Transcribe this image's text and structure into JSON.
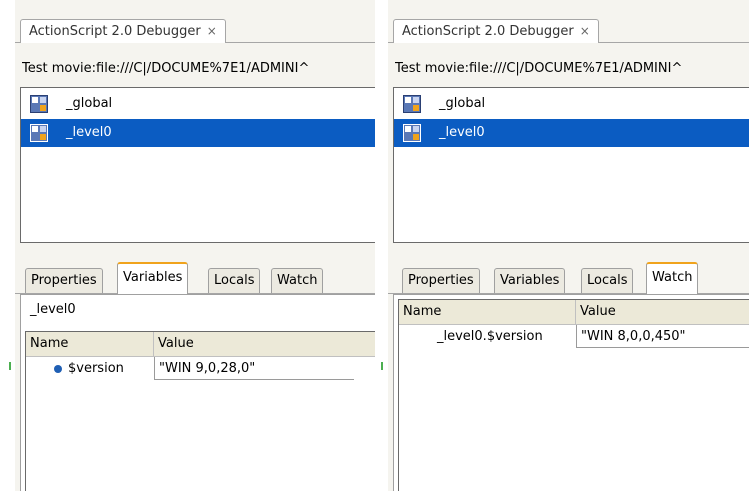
{
  "left": {
    "tab_title": "ActionScript 2.0 Debugger",
    "close_glyph": "×",
    "movie_path": "Test movie:file:///C|/DOCUME%7E1/ADMINI^",
    "tree": [
      {
        "label": "_global",
        "icon": "movieclip-icon",
        "selected": false
      },
      {
        "label": "_level0",
        "icon": "movieclip-icon",
        "selected": true
      }
    ],
    "tabs": [
      "Properties",
      "Variables",
      "Locals",
      "Watch"
    ],
    "active_tab": "Variables",
    "level_label": "_level0",
    "grid": {
      "headers": [
        "Name",
        "Value"
      ],
      "rows": [
        {
          "name": "$version",
          "value": "\"WIN 9,0,28,0\"",
          "bullet": "dot-icon"
        }
      ]
    }
  },
  "right": {
    "tab_title": "ActionScript 2.0 Debugger",
    "close_glyph": "×",
    "movie_path": "Test movie:file:///C|/DOCUME%7E1/ADMINI^",
    "tree": [
      {
        "label": "_global",
        "icon": "movieclip-icon",
        "selected": false
      },
      {
        "label": "_level0",
        "icon": "movieclip-icon",
        "selected": true
      }
    ],
    "tabs": [
      "Properties",
      "Variables",
      "Locals",
      "Watch"
    ],
    "active_tab": "Watch",
    "grid": {
      "headers": [
        "Name",
        "Value"
      ],
      "rows": [
        {
          "name": "_level0.$version",
          "value": "\"WIN 8,0,0,450\""
        }
      ]
    }
  },
  "colors": {
    "selection": "#0b5cc2",
    "active_tab_accent": "#f0a31c",
    "bullet": "#1f5fb4"
  }
}
